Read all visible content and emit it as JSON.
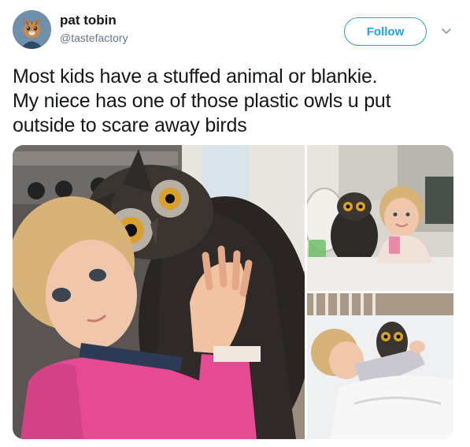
{
  "user": {
    "name": "pat tobin",
    "handle": "@tastefactory",
    "avatar_icon": "cat-avatar-icon"
  },
  "follow_button": {
    "label": "Follow"
  },
  "menu": {
    "icon": "chevron-down-icon"
  },
  "tweet": {
    "lines": [
      "Most kids have a stuffed animal or blankie.",
      "My niece has one of those plastic owls u put",
      "outside to scare away birds"
    ]
  },
  "media": {
    "count": 3,
    "photos": [
      {
        "subject": "toddler hugging plastic owl"
      },
      {
        "subject": "toddler at table next to owl"
      },
      {
        "subject": "toddler in crib with owl"
      }
    ]
  },
  "colors": {
    "accent": "#1da1f2",
    "text": "#14171a",
    "secondary": "#657786"
  }
}
